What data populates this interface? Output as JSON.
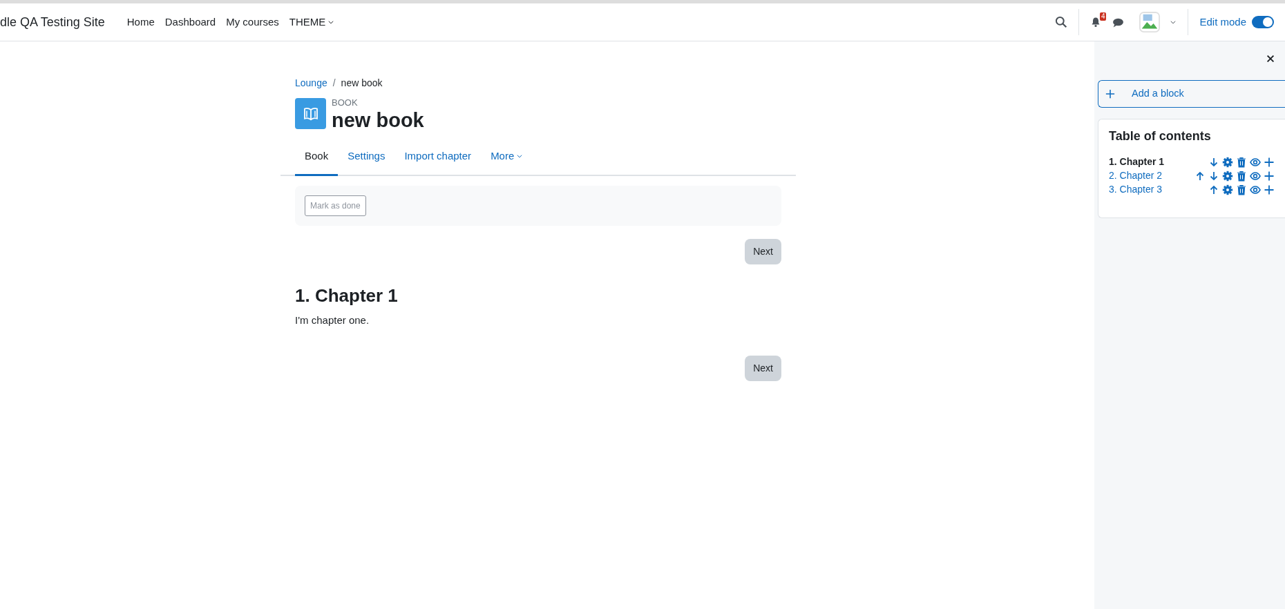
{
  "navbar": {
    "site_name": "dle QA Testing Site",
    "links": [
      {
        "label": "Home",
        "dropdown": false
      },
      {
        "label": "Dashboard",
        "dropdown": false
      },
      {
        "label": "My courses",
        "dropdown": false
      },
      {
        "label": "THEME",
        "dropdown": true
      }
    ],
    "notification_count": "4",
    "edit_mode": {
      "label": "Edit mode",
      "on": true
    }
  },
  "breadcrumb_separator": "/",
  "breadcrumb": [
    {
      "label": "Lounge",
      "link": true
    },
    {
      "label": "new book",
      "link": false
    }
  ],
  "header": {
    "type_label": "BOOK",
    "title": "new book"
  },
  "tabs": [
    {
      "label": "Book",
      "selected": true,
      "dropdown": false
    },
    {
      "label": "Settings",
      "selected": false,
      "dropdown": false
    },
    {
      "label": "Import chapter",
      "selected": false,
      "dropdown": false
    },
    {
      "label": "More",
      "selected": false,
      "dropdown": true
    }
  ],
  "completion": {
    "label": "Mark as done",
    "disabled": true
  },
  "next_top": "Next",
  "chapter": {
    "title": "1. Chapter 1",
    "text": "I'm chapter one."
  },
  "next_bottom": "Next",
  "drawer": {
    "add_block": "Add a block",
    "toc": {
      "title": "Table of contents",
      "chapters": [
        {
          "label": "1. Chapter 1",
          "selected": true,
          "actions": [
            {
              "kind": "down"
            },
            {
              "kind": "settings"
            },
            {
              "kind": "delete"
            },
            {
              "kind": "hide"
            },
            {
              "kind": "add"
            }
          ]
        },
        {
          "label": "2. Chapter 2",
          "selected": false,
          "actions": [
            {
              "kind": "up"
            },
            {
              "kind": "down"
            },
            {
              "kind": "settings"
            },
            {
              "kind": "delete"
            },
            {
              "kind": "hide"
            },
            {
              "kind": "add"
            }
          ]
        },
        {
          "label": "3. Chapter 3",
          "selected": false,
          "actions": [
            {
              "kind": "up"
            },
            {
              "kind": "settings"
            },
            {
              "kind": "delete"
            },
            {
              "kind": "hide"
            },
            {
              "kind": "add"
            }
          ]
        }
      ]
    }
  }
}
